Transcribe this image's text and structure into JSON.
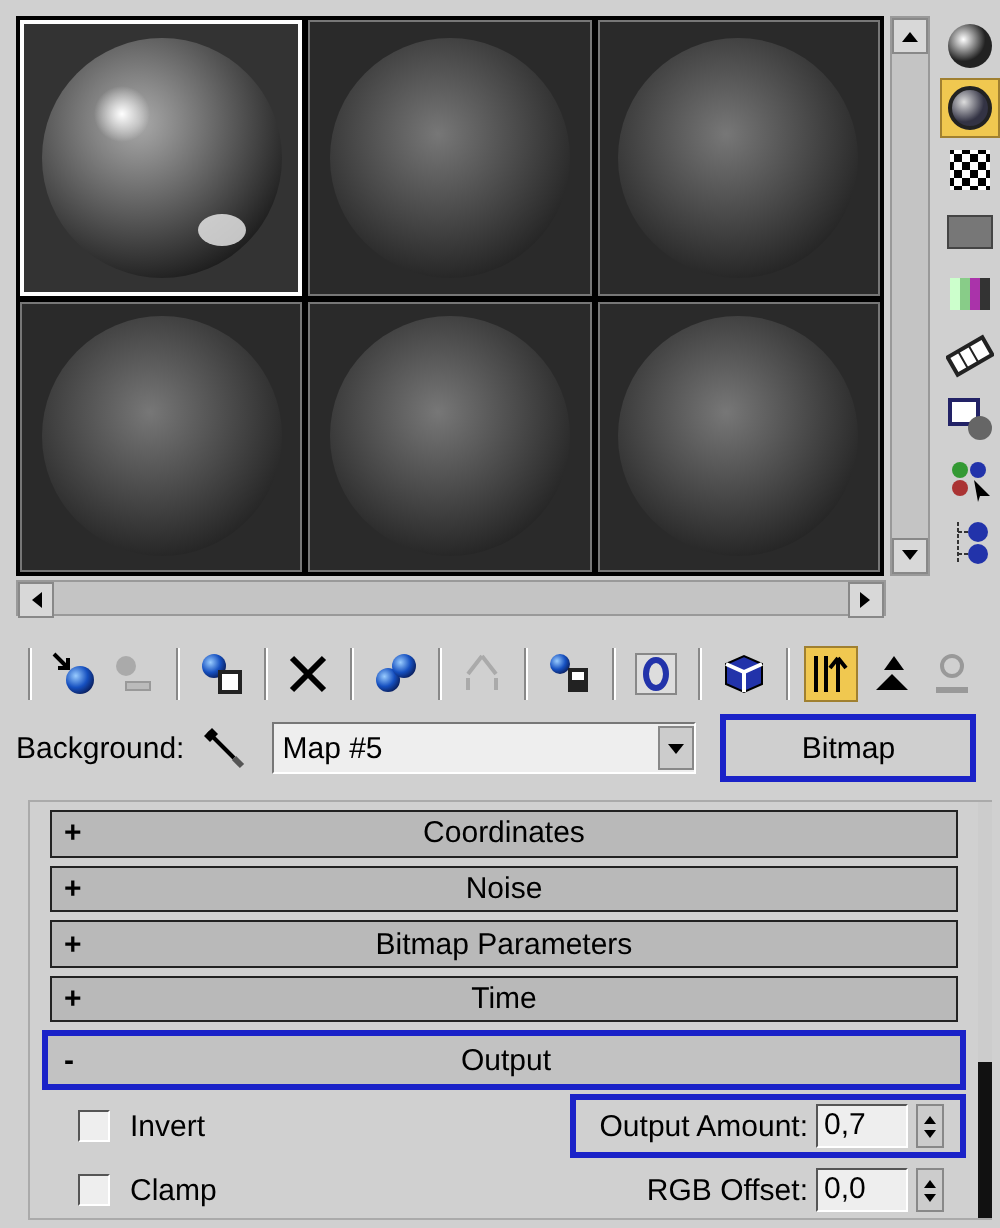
{
  "samples": [
    {
      "selected": true
    },
    {
      "selected": false
    },
    {
      "selected": false
    },
    {
      "selected": false
    },
    {
      "selected": false
    },
    {
      "selected": false
    }
  ],
  "side_toolbar": [
    {
      "active": false
    },
    {
      "active": true
    },
    {
      "active": false
    },
    {
      "active": false
    },
    {
      "active": false
    },
    {
      "active": false
    },
    {
      "active": false
    },
    {
      "active": false
    },
    {
      "active": false
    }
  ],
  "toolbar": [
    {
      "active": false
    },
    {
      "active": false
    },
    {
      "active": false
    },
    {
      "active": false
    },
    {
      "active": false
    },
    {
      "active": false
    },
    {
      "active": false
    },
    {
      "active": false
    },
    {
      "active": false
    },
    {
      "active": true
    },
    {
      "active": false
    },
    {
      "active": false
    }
  ],
  "background": {
    "label": "Background:",
    "map": "Map #5",
    "type_button": {
      "label": "Bitmap",
      "highlighted": true
    }
  },
  "rollouts": [
    {
      "sign": "+",
      "title": "Coordinates",
      "expanded": false,
      "highlighted": false
    },
    {
      "sign": "+",
      "title": "Noise",
      "expanded": false,
      "highlighted": false
    },
    {
      "sign": "+",
      "title": "Bitmap Parameters",
      "expanded": false,
      "highlighted": false
    },
    {
      "sign": "+",
      "title": "Time",
      "expanded": false,
      "highlighted": false
    },
    {
      "sign": "-",
      "title": "Output",
      "expanded": true,
      "highlighted": true
    }
  ],
  "output": [
    {
      "checkbox": "Invert",
      "checked": false,
      "field_label": "Output Amount:",
      "value": "0,7",
      "highlighted": true
    },
    {
      "checkbox": "Clamp",
      "checked": false,
      "field_label": "RGB Offset:",
      "value": "0,0",
      "highlighted": false
    }
  ]
}
